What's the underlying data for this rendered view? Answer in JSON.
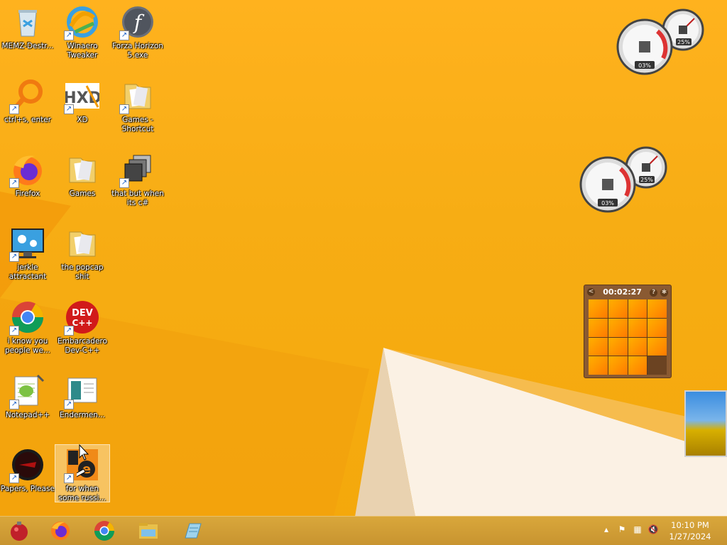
{
  "desktop": {
    "icons": [
      {
        "label": "MEMZ-Destr...",
        "icon": "recycle-bin-icon"
      },
      {
        "label": "Winaero Tweaker",
        "icon": "winaero-tweaker-icon"
      },
      {
        "label": "Forza Horizon 5.exe",
        "icon": "flash-player-icon"
      },
      {
        "label": "ctrl+s, enter",
        "icon": "magnifier-app-icon"
      },
      {
        "label": "XD",
        "icon": "hxd-icon"
      },
      {
        "label": "Games - Shortcut",
        "icon": "folder-icon"
      },
      {
        "label": "Firefox",
        "icon": "firefox-icon"
      },
      {
        "label": "Games",
        "icon": "folder-icon"
      },
      {
        "label": "that but when its c#",
        "icon": "stacked-windows-icon"
      },
      {
        "label": "jerkle attractant",
        "icon": "monitor-gears-icon"
      },
      {
        "label": "the popcap shit",
        "icon": "folder-icon"
      },
      {
        "label": "i know you people we...",
        "icon": "chrome-icon"
      },
      {
        "label": "Embarcadero Dev-C++",
        "icon": "devcpp-icon"
      },
      {
        "label": "Notepad++",
        "icon": "notepadpp-icon"
      },
      {
        "label": "Endermen...",
        "icon": "document-icon"
      },
      {
        "label": "Papers, Please",
        "icon": "papers-please-icon"
      },
      {
        "label": "for when some russi...",
        "icon": "e-app-icon"
      }
    ],
    "dev_icon_text": {
      "line1": "DEV",
      "line2": "C++"
    },
    "hxd_text": "HXD"
  },
  "gadgets": {
    "cpu_meter_1": {
      "cpu": "03%",
      "mem": "25%"
    },
    "cpu_meter_2": {
      "cpu": "03%",
      "mem": "25%"
    },
    "puzzle": {
      "timer": "00:02:27",
      "help": "?",
      "nav": "<",
      "tiles": 16,
      "empty_index": 15
    }
  },
  "taskbar": {
    "buttons": [
      "start-orb-icon",
      "firefox-icon",
      "chrome-icon",
      "file-explorer-icon",
      "notepad-icon"
    ],
    "tray": {
      "chevron": "▴",
      "flag": "⚑",
      "network": "▦",
      "volume": "🔇"
    },
    "clock": {
      "time": "10:10 PM",
      "date": "1/27/2024"
    }
  },
  "colors": {
    "wallpaper": "#f7ad14",
    "taskbar": "#c89430"
  }
}
